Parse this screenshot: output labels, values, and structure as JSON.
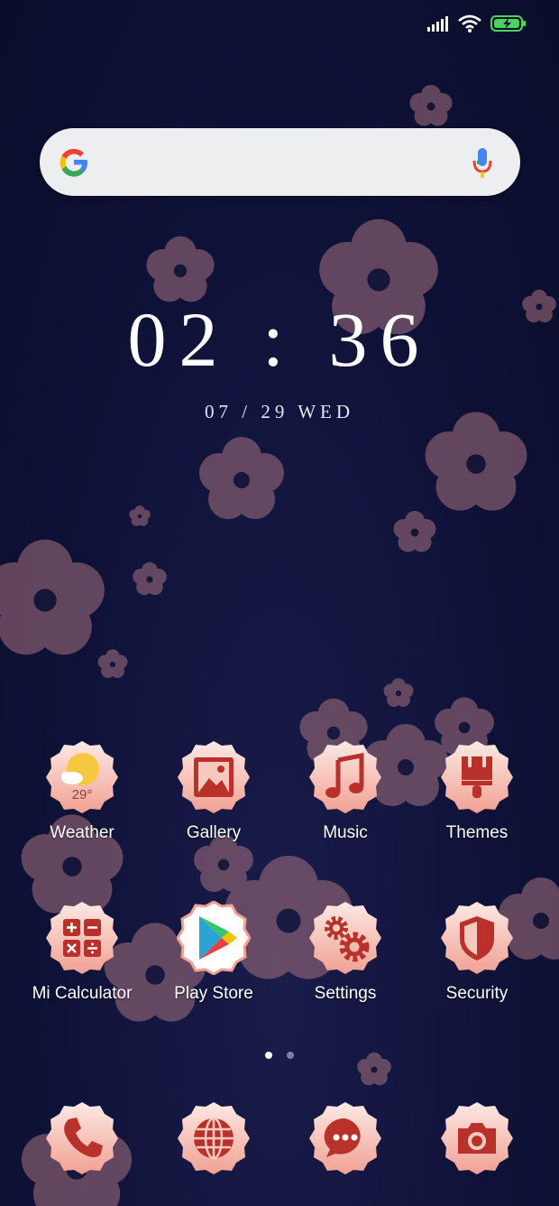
{
  "status": {
    "icons": [
      "signal-icon",
      "wifi-icon",
      "battery-charging-icon"
    ]
  },
  "search": {
    "placeholder": "",
    "logo": "google-g-icon",
    "mic": "mic-icon"
  },
  "clock": {
    "time": "02 : 36",
    "date": "07 / 29 WED"
  },
  "apps_row1": [
    {
      "label": "Weather",
      "icon": "weather-icon",
      "temp": "29°"
    },
    {
      "label": "Gallery",
      "icon": "gallery-icon"
    },
    {
      "label": "Music",
      "icon": "music-icon"
    },
    {
      "label": "Themes",
      "icon": "themes-brush-icon"
    }
  ],
  "apps_row2": [
    {
      "label": "Mi Calculator",
      "icon": "calculator-icon"
    },
    {
      "label": "Play Store",
      "icon": "play-store-icon"
    },
    {
      "label": "Settings",
      "icon": "gears-icon"
    },
    {
      "label": "Security",
      "icon": "shield-icon"
    }
  ],
  "dock": [
    {
      "icon": "phone-icon"
    },
    {
      "icon": "browser-globe-icon"
    },
    {
      "icon": "messages-icon"
    },
    {
      "icon": "camera-icon"
    }
  ],
  "page_indicator": {
    "pages": 2,
    "current": 1
  },
  "colors": {
    "background": "#0f1238",
    "icon_badge_top": "#fbe3de",
    "icon_badge_bottom": "#f1a89b",
    "glyph": "#c0392f",
    "petal": "#8a5e6e"
  }
}
